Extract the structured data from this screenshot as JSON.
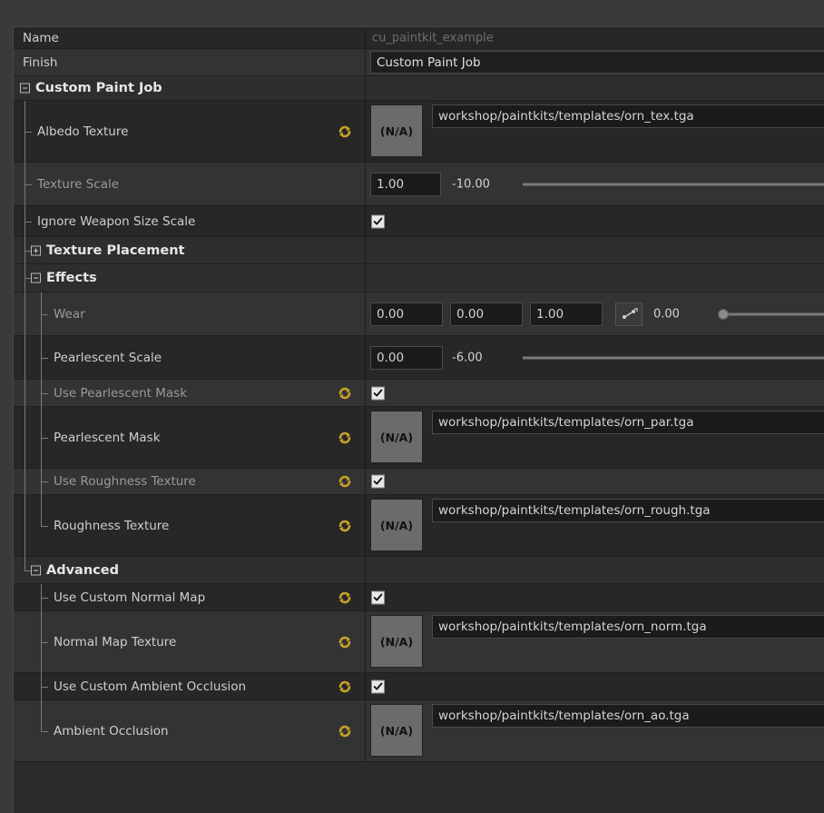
{
  "colors": {
    "panel": "#2b2b2b",
    "accent_icon": "#c9a227",
    "checkbox": "#e8e8e8"
  },
  "name_row": {
    "label": "Name",
    "value": "cu_paintkit_example"
  },
  "finish_row": {
    "label": "Finish",
    "value": "Custom Paint Job"
  },
  "custom_paint_job": {
    "label": "Custom Paint Job"
  },
  "albedo": {
    "label": "Albedo Texture",
    "button": "(N/A)",
    "path": "workshop/paintkits/templates/orn_tex.tga",
    "reset_icon": "reset-icon"
  },
  "texture_scale": {
    "label": "Texture Scale",
    "value": "1.00",
    "min": "-10.00"
  },
  "ignore_weapon_size_scale": {
    "label": "Ignore Weapon Size Scale",
    "checked": true
  },
  "texture_placement": {
    "label": "Texture Placement"
  },
  "effects": {
    "label": "Effects"
  },
  "wear": {
    "label": "Wear",
    "v1": "0.00",
    "v2": "0.00",
    "v3": "1.00",
    "v4": "0.00"
  },
  "pearlescent_scale": {
    "label": "Pearlescent Scale",
    "value": "0.00",
    "min": "-6.00"
  },
  "use_pearlescent_mask": {
    "label": "Use Pearlescent Mask",
    "checked": true
  },
  "pearlescent_mask": {
    "label": "Pearlescent Mask",
    "button": "(N/A)",
    "path": "workshop/paintkits/templates/orn_par.tga"
  },
  "use_roughness_texture": {
    "label": "Use Roughness Texture",
    "checked": true
  },
  "roughness_texture": {
    "label": "Roughness Texture",
    "button": "(N/A)",
    "path": "workshop/paintkits/templates/orn_rough.tga"
  },
  "advanced": {
    "label": "Advanced"
  },
  "use_custom_normal_map": {
    "label": "Use Custom Normal Map",
    "checked": true
  },
  "normal_map_texture": {
    "label": "Normal Map Texture",
    "button": "(N/A)",
    "path": "workshop/paintkits/templates/orn_norm.tga"
  },
  "use_custom_ambient_occlusion": {
    "label": "Use Custom Ambient Occlusion",
    "checked": true
  },
  "ambient_occlusion": {
    "label": "Ambient Occlusion",
    "button": "(N/A)",
    "path": "workshop/paintkits/templates/orn_ao.tga"
  }
}
